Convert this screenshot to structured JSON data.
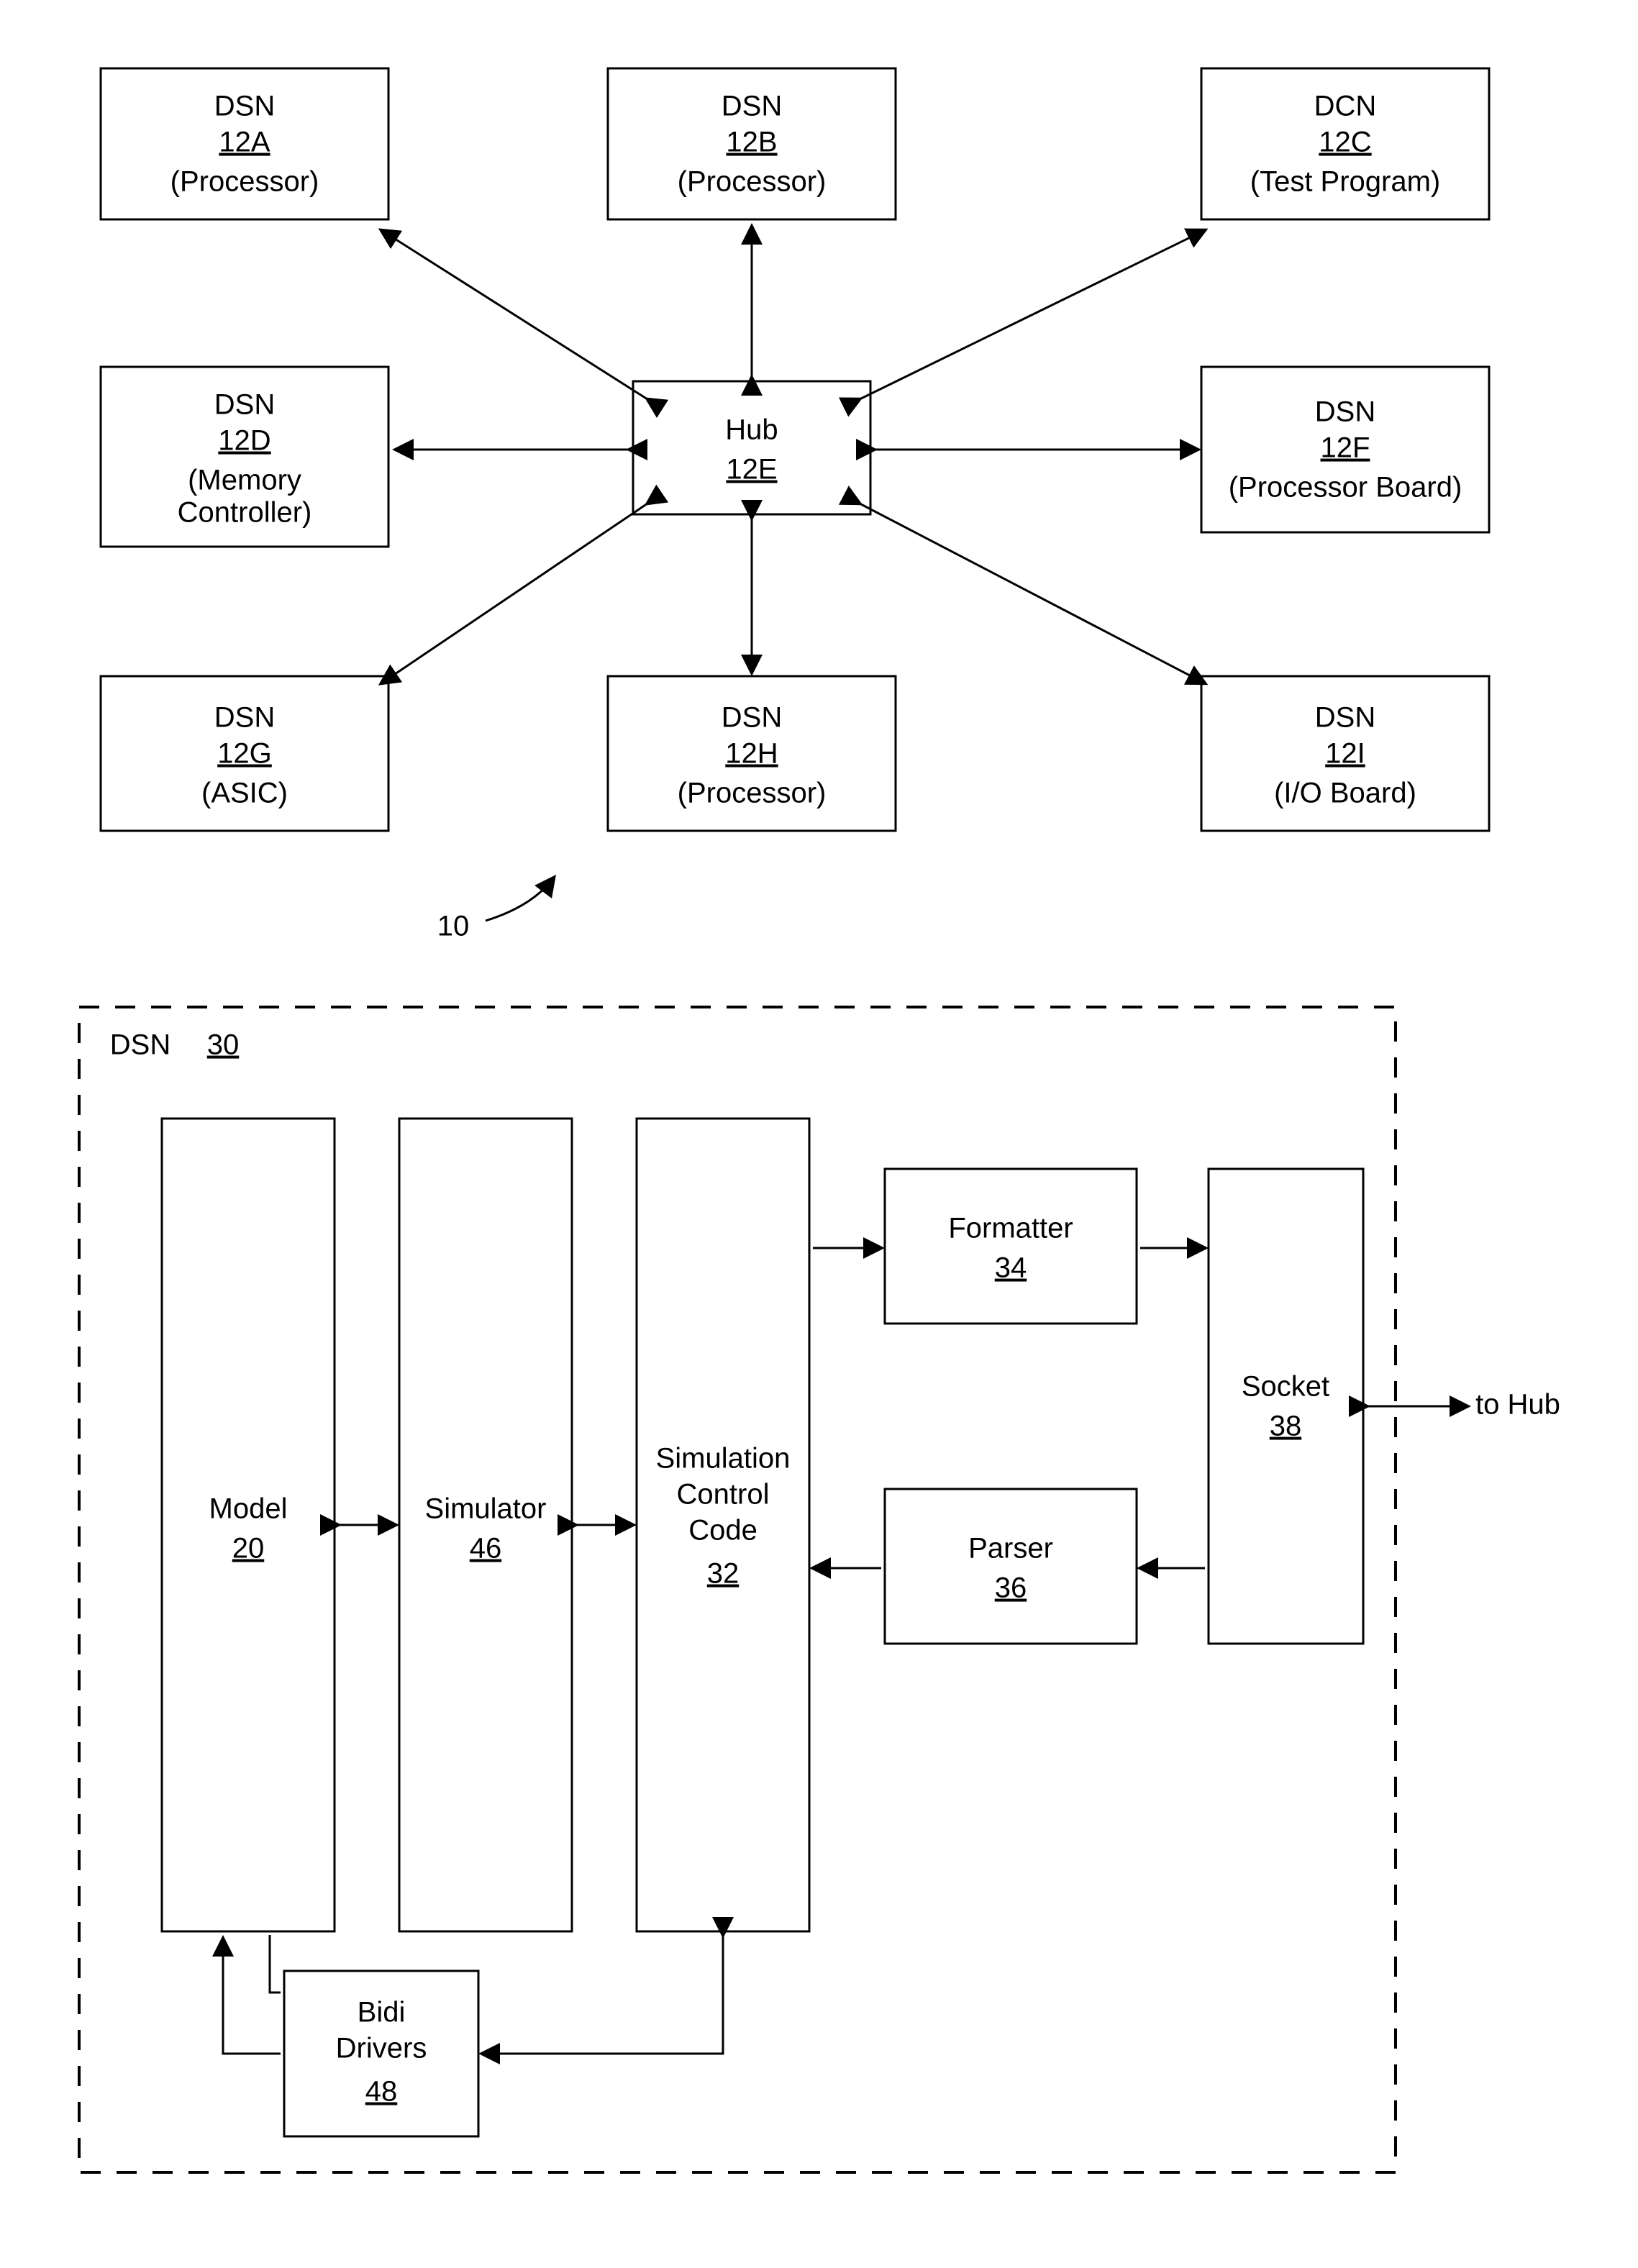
{
  "fig_ref": "10",
  "hub": {
    "title": "Hub",
    "ref": "12E"
  },
  "nodes": {
    "A": {
      "title": "DSN",
      "ref": "12A",
      "sub": "(Processor)"
    },
    "B": {
      "title": "DSN",
      "ref": "12B",
      "sub": "(Processor)"
    },
    "C": {
      "title": "DCN",
      "ref": "12C",
      "sub": "(Test Program)"
    },
    "D": {
      "title": "DSN",
      "ref": "12D",
      "sub": "(Memory Controller)",
      "sub2": "Controller"
    },
    "F": {
      "title": "DSN",
      "ref": "12F",
      "sub": "(Processor Board)"
    },
    "G": {
      "title": "DSN",
      "ref": "12G",
      "sub": "(ASIC)"
    },
    "H": {
      "title": "DSN",
      "ref": "12H",
      "sub": "(Processor)"
    },
    "I": {
      "title": "DSN",
      "ref": "12I",
      "sub": "(I/O Board)"
    }
  },
  "dsn_block": {
    "label": "DSN",
    "ref": "30",
    "model": {
      "title": "Model",
      "ref": "20"
    },
    "sim": {
      "title": "Simulator",
      "ref": "46"
    },
    "scc": {
      "line1": "Simulation",
      "line2": "Control",
      "line3": "Code",
      "ref": "32"
    },
    "formatter": {
      "title": "Formatter",
      "ref": "34"
    },
    "parser": {
      "title": "Parser",
      "ref": "36"
    },
    "socket": {
      "title": "Socket",
      "ref": "38"
    },
    "bidi": {
      "line1": "Bidi",
      "line2": "Drivers",
      "ref": "48"
    },
    "to_hub": "to Hub"
  }
}
